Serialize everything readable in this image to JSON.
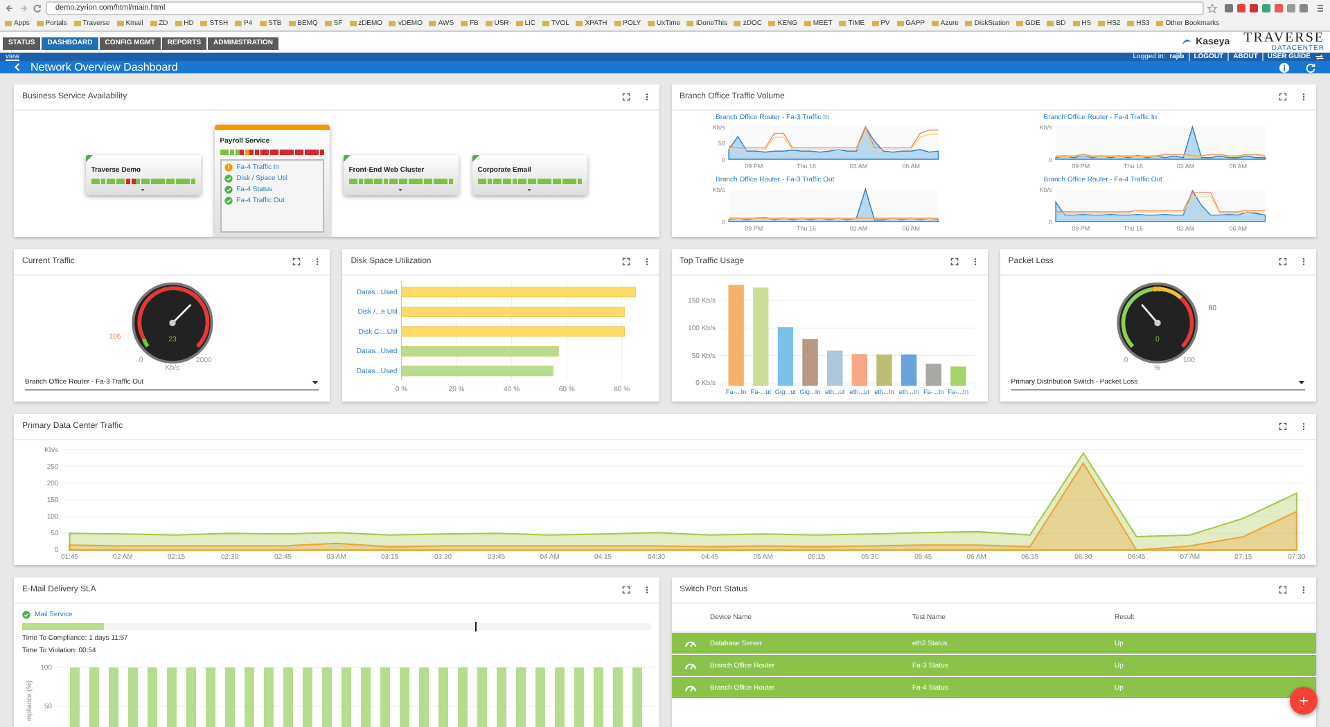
{
  "browser": {
    "url": "demo.zyrion.com/html/main.html",
    "bookmarks": [
      "Apps",
      "Portals",
      "Traverse",
      "Kmail",
      "ZD",
      "HD",
      "STSH",
      "P4",
      "STB",
      "BEMQ",
      "SF",
      "zDEMO",
      "vDEMO",
      "AWS",
      "FB",
      "USR",
      "LIC",
      "TVOL",
      "XPATH",
      "POLY",
      "UxTime",
      "iDoneThis",
      "zDOC",
      "KENG",
      "MEET",
      "TIME",
      "PV",
      "GAPP",
      "Azure",
      "DiskStation",
      "GDE",
      "BD",
      "HS",
      "HS2",
      "HS3",
      "Other Bookmarks"
    ]
  },
  "nav": {
    "tabs": [
      {
        "label": "STATUS",
        "selected": false
      },
      {
        "label": "DASHBOARD",
        "selected": true
      },
      {
        "label": "CONFIG MGMT",
        "selected": false
      },
      {
        "label": "REPORTS",
        "selected": false
      },
      {
        "label": "ADMINISTRATION",
        "selected": false
      }
    ],
    "logo": {
      "brand": "Kaseya",
      "product": "TRAVERSE",
      "edition": "DATACENTER"
    }
  },
  "subbar": {
    "link": "view",
    "logged_in_label": "Logged in:",
    "user": "rajib",
    "links": [
      "LOGOUT",
      "ABOUT",
      "USER GUIDE"
    ]
  },
  "titlebar": {
    "title": "Network Overview Dashboard"
  },
  "business_services": {
    "title": "Business Service Availability",
    "services": [
      {
        "name": "Traverse Demo",
        "warning": false,
        "expanded": false,
        "segments": [
          {
            "color": "#7cc242"
          },
          {
            "color": "#7cc242"
          },
          {
            "color": "#7cc242"
          },
          {
            "color": "#7cc242"
          },
          {
            "color": "#7cc242"
          },
          {
            "color": "#7cc242"
          },
          {
            "color": "#7cc242"
          },
          {
            "color": "#d9262b"
          },
          {
            "color": "#d9262b"
          },
          {
            "color": "#7cc242"
          },
          {
            "color": "#7cc242"
          },
          {
            "color": "#7cc242"
          },
          {
            "color": "#7cc242"
          },
          {
            "color": "#7cc242"
          },
          {
            "color": "#7cc242"
          },
          {
            "color": "#7cc242"
          },
          {
            "color": "#7cc242"
          },
          {
            "color": "#7cc242"
          },
          {
            "color": "#7cc242"
          },
          {
            "color": "#7cc242"
          },
          {
            "color": "#7cc242"
          }
        ]
      },
      {
        "name": "Payroll Service",
        "warning": true,
        "expanded": true,
        "segments": [
          {
            "color": "#7cc242"
          },
          {
            "color": "#7cc242"
          },
          {
            "color": "#7cc242"
          },
          {
            "color": "#7cc242"
          },
          {
            "color": "#d9262b"
          },
          {
            "color": "#f39c12"
          },
          {
            "color": "#d9262b"
          },
          {
            "color": "#d9262b"
          },
          {
            "color": "#d9262b"
          },
          {
            "color": "#d9262b"
          },
          {
            "color": "#d9262b"
          },
          {
            "color": "#d9262b"
          },
          {
            "color": "#d9262b"
          },
          {
            "color": "#d9262b"
          },
          {
            "color": "#d9262b"
          },
          {
            "color": "#d9262b"
          },
          {
            "color": "#d9262b"
          },
          {
            "color": "#d9262b"
          },
          {
            "color": "#d9262b"
          },
          {
            "color": "#d9262b"
          },
          {
            "color": "#d9262b"
          }
        ],
        "tests": [
          {
            "name": "Fa-4 Traffic In",
            "warning": true
          },
          {
            "name": "Disk / Space Util",
            "warning": false
          },
          {
            "name": "Fa-4 Status",
            "warning": false
          },
          {
            "name": "Fa-4 Traffic Out",
            "warning": false
          }
        ]
      },
      {
        "name": "Front-End Web Cluster",
        "warning": false,
        "expanded": false,
        "segments": [
          {
            "color": "#7cc242"
          },
          {
            "color": "#7cc242"
          },
          {
            "color": "#7cc242"
          },
          {
            "color": "#7cc242"
          },
          {
            "color": "#7cc242"
          },
          {
            "color": "#7cc242"
          },
          {
            "color": "#7cc242"
          },
          {
            "color": "#7cc242"
          },
          {
            "color": "#7cc242"
          },
          {
            "color": "#7cc242"
          },
          {
            "color": "#7cc242"
          },
          {
            "color": "#7cc242"
          },
          {
            "color": "#7cc242"
          },
          {
            "color": "#7cc242"
          },
          {
            "color": "#7cc242"
          },
          {
            "color": "#7cc242"
          },
          {
            "color": "#7cc242"
          },
          {
            "color": "#7cc242"
          },
          {
            "color": "#7cc242"
          },
          {
            "color": "#7cc242"
          },
          {
            "color": "#7cc242"
          }
        ]
      },
      {
        "name": "Corporate Email",
        "warning": false,
        "expanded": false,
        "segments": [
          {
            "color": "#7cc242"
          },
          {
            "color": "#7cc242"
          },
          {
            "color": "#7cc242"
          },
          {
            "color": "#7cc242"
          },
          {
            "color": "#7cc242"
          },
          {
            "color": "#7cc242"
          },
          {
            "color": "#7cc242"
          },
          {
            "color": "#7cc242"
          },
          {
            "color": "#7cc242"
          },
          {
            "color": "#7cc242"
          },
          {
            "color": "#7cc242"
          },
          {
            "color": "#7cc242"
          },
          {
            "color": "#7cc242"
          },
          {
            "color": "#7cc242"
          },
          {
            "color": "#7cc242"
          },
          {
            "color": "#7cc242"
          },
          {
            "color": "#7cc242"
          },
          {
            "color": "#7cc242"
          },
          {
            "color": "#7cc242"
          },
          {
            "color": "#7cc242"
          },
          {
            "color": "#7cc242"
          }
        ]
      }
    ]
  },
  "branch_traffic": {
    "title": "Branch Office Traffic Volume",
    "charts": [
      {
        "title": "Branch Office Router - Fa-3 Traffic In",
        "y_labels": [
          "Kb/s",
          "50",
          "0"
        ],
        "x_labels": [
          "09 PM",
          "Thu 16",
          "03 AM",
          "06 AM"
        ]
      },
      {
        "title": "Branch Office Router - Fa-4 Traffic In",
        "y_labels": [
          "Kb/s",
          "0"
        ],
        "x_labels": [
          "09 PM",
          "Thu 16",
          "03 AM",
          "06 AM"
        ]
      },
      {
        "title": "Branch Office Router - Fa-3 Traffic Out",
        "y_labels": [
          "Kb/s",
          "0"
        ],
        "x_labels": [
          "09 PM",
          "Thu 16",
          "03 AM",
          "06 AM"
        ]
      },
      {
        "title": "Branch Office Router - Fa-4 Traffic Out",
        "y_labels": [
          "Kb/s",
          "0"
        ],
        "x_labels": [
          "09 PM",
          "Thu 16",
          "03 AM",
          "06 AM"
        ]
      }
    ]
  },
  "current_traffic": {
    "title": "Current Traffic",
    "gauge": {
      "labels": [
        {
          "text": "106",
          "kind": "warning"
        },
        {
          "text": "0",
          "kind": "min"
        },
        {
          "text": "2000",
          "kind": "max"
        },
        {
          "text": "23",
          "kind": "value"
        },
        {
          "text": "Kb/s",
          "kind": "unit"
        }
      ]
    },
    "select": "Branch Office Router - Fa-3 Traffic Out"
  },
  "disk_space": {
    "title": "Disk Space Utilization",
    "chart_data": {
      "type": "bar",
      "orientation": "horizontal",
      "categories": [
        "Datas...Used",
        "Disk /...e Util",
        "Disk C:...Util",
        "Datas...Used",
        "Datas...Used"
      ],
      "values": [
        85,
        81,
        81,
        57,
        55
      ],
      "colors": [
        "#ffd966",
        "#ffd966",
        "#ffd966",
        "#b6dc8f",
        "#b6dc8f"
      ],
      "xlim": [
        0,
        86
      ],
      "grid": true,
      "xticks": [
        {
          "value": 0,
          "label": "0 %"
        },
        {
          "value": 20,
          "label": "20 %"
        },
        {
          "value": 40,
          "label": "40 %"
        },
        {
          "value": 60,
          "label": "60 %"
        },
        {
          "value": 80,
          "label": "80 %"
        }
      ]
    }
  },
  "top_traffic": {
    "title": "Top Traffic Usage",
    "chart_data": {
      "type": "bar",
      "categories": [
        "Fa-...In",
        "Fa-...ut",
        "Gig...ut",
        "Gig...In",
        "eth...ut",
        "eth...ut",
        "eth...In",
        "eth...In",
        "Fa-...In",
        "Fa-...In"
      ],
      "values": [
        179,
        174,
        102,
        80,
        59,
        53,
        52,
        52,
        35,
        30
      ],
      "colors": [
        "#f5b26b",
        "#c9df97",
        "#7cc0ea",
        "#b89783",
        "#adc6d9",
        "#f9a887",
        "#bdbd72",
        "#6aa3da",
        "#a7aaa3",
        "#a3d467"
      ],
      "ylim": [
        0,
        185
      ],
      "grid": true,
      "yticks": [
        {
          "value": 0,
          "label": "0 Kb/s"
        },
        {
          "value": 50,
          "label": "50 Kb/s"
        },
        {
          "value": 100,
          "label": "100 Kb/s"
        },
        {
          "value": 150,
          "label": "150 Kb/s"
        }
      ]
    }
  },
  "packet_loss": {
    "title": "Packet Loss",
    "gauge": {
      "labels": [
        {
          "text": "55",
          "kind": "warning"
        },
        {
          "text": "80",
          "kind": "critical"
        },
        {
          "text": "0",
          "kind": "min"
        },
        {
          "text": "100",
          "kind": "max"
        },
        {
          "text": "0",
          "kind": "value"
        },
        {
          "text": "%",
          "kind": "unit"
        }
      ]
    },
    "select": "Primary Distribution Switch - Packet Loss"
  },
  "datacenter": {
    "title": "Primary Data Center Traffic",
    "chart_data": {
      "type": "area",
      "categories": [
        "01:45",
        "02 AM",
        "02:15",
        "02:30",
        "02:45",
        "03 AM",
        "03:15",
        "03:30",
        "03:45",
        "04 AM",
        "04:15",
        "04:30",
        "04:45",
        "05 AM",
        "05:15",
        "05:30",
        "05:45",
        "06 AM",
        "06:15",
        "06:30",
        "06:45",
        "07 AM",
        "07:15",
        "07:30"
      ],
      "series": [
        {
          "color": "#a5c64a",
          "values": [
            50,
            48,
            45,
            50,
            48,
            52,
            45,
            48,
            50,
            45,
            48,
            52,
            45,
            48,
            45,
            48,
            52,
            55,
            45,
            290,
            40,
            45,
            95,
            170
          ]
        },
        {
          "color": "#f0a030",
          "values": [
            15,
            12,
            12,
            12,
            12,
            20,
            10,
            12,
            12,
            12,
            12,
            12,
            10,
            12,
            10,
            12,
            15,
            15,
            10,
            260,
            0,
            12,
            40,
            115
          ]
        }
      ],
      "ylim": [
        0,
        300
      ],
      "grid": true,
      "yticks": [
        0,
        50,
        100,
        150,
        200,
        250,
        {
          "value": 300,
          "label": "Kb/s"
        }
      ]
    }
  },
  "sla": {
    "title": "E-Mail Delivery SLA",
    "service": "Mail Service",
    "level": 0.13,
    "lines": [
      "Time To Compliance: 1 days 11:57",
      "Time To Violation: 00:54"
    ],
    "chart_data": {
      "type": "bar",
      "ylabel": "mpliance (%)",
      "values": [
        100,
        100,
        100,
        100,
        100,
        100,
        100,
        100,
        100,
        100,
        100,
        100,
        100,
        100,
        100,
        100,
        100,
        100,
        100,
        100,
        100,
        100,
        100,
        100,
        100,
        100,
        100,
        100,
        100,
        100
      ],
      "ylim": [
        0,
        100
      ],
      "grid": true,
      "yticks": [
        50,
        100
      ]
    }
  },
  "switch_ports": {
    "title": "Switch Port Status",
    "columns": [
      "Device Name",
      "Test Name",
      "Result"
    ],
    "rows": [
      [
        "Database Server",
        "eth2 Status",
        "Up"
      ],
      [
        "Branch Office Router",
        "Fa-3 Status",
        "Up"
      ],
      [
        "Branch Office Router",
        "Fa-4 Status",
        "Up"
      ]
    ]
  },
  "fab": {
    "label": "+"
  }
}
